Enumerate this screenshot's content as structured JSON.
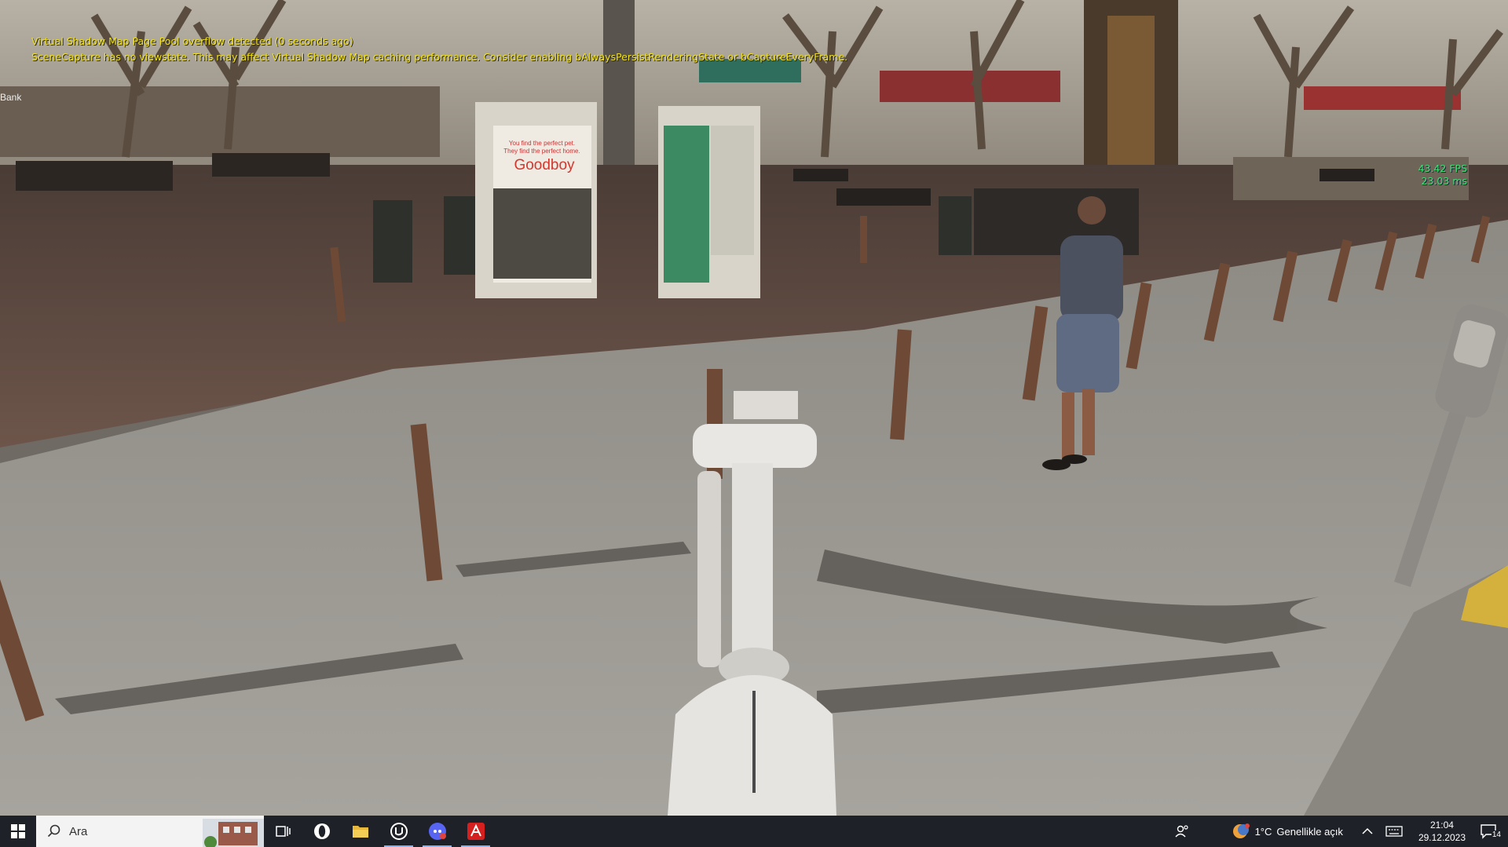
{
  "overlay": {
    "warning_1": "Virtual Shadow Map Page Pool overflow detected (0 seconds ago)",
    "warning_2": "SceneCapture has no viewstate. This may affect Virtual Shadow Map caching performance. Consider enabling bAlwaysPersistRenderingState or bCaptureEveryFrame.",
    "fps": "43.42 FPS",
    "frame_time": "23.03 ms"
  },
  "scene": {
    "poster_1_line1": "You find the perfect pet.",
    "poster_1_line2": "They find the perfect home.",
    "poster_1_brand": "Goodboy",
    "sign_bank": "Bank"
  },
  "taskbar": {
    "search_placeholder": "Ara",
    "apps": [
      "task-view",
      "opera",
      "file-explorer",
      "unreal-engine",
      "discord",
      "acrobat"
    ],
    "weather_temp": "1°C",
    "weather_desc": "Genellikle açık",
    "time": "21:04",
    "date": "29.12.2023",
    "notifications": "14"
  },
  "colors": {
    "overlay_warning": "#f2e21c",
    "overlay_stats": "#3fe07a",
    "taskbar_bg": "#1f2128"
  }
}
